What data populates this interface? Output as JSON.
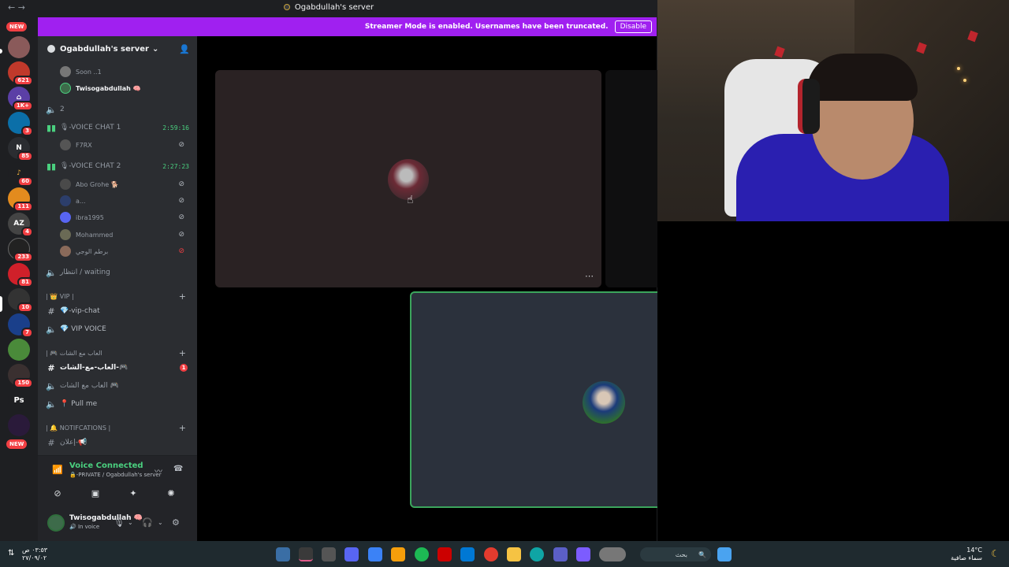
{
  "window": {
    "title": "Ogabdullah's server",
    "nav_back": "←",
    "nav_forward": "→"
  },
  "banner": {
    "message": "Streamer Mode is enabled. Usernames have been truncated.",
    "button": "Disable"
  },
  "rail": {
    "badges": [
      "NEW",
      "621",
      "1K+",
      "3",
      "85",
      "60",
      "111",
      "4",
      "233",
      "81",
      "10",
      "7",
      "150",
      "Ps",
      "NEW"
    ]
  },
  "sidebar": {
    "server_name": "Ogabdullah's server",
    "dropdown_icon": "⌄",
    "members_top": [
      {
        "name": "Soon ..1"
      },
      {
        "name": "Twisogabdullah 🧠"
      }
    ],
    "channel_2": "2",
    "voice1": {
      "name": "🎙-VOICE CHAT 1",
      "timer": "2:59:16",
      "members": [
        {
          "name": "F7RX"
        }
      ]
    },
    "voice2": {
      "name": "🎙-VOICE CHAT 2",
      "timer": "2:27:23",
      "members": [
        {
          "name": "Abo Grohe 🐕"
        },
        {
          "name": "a..."
        },
        {
          "name": "ibra1995"
        },
        {
          "name": "Mohammed"
        },
        {
          "name": "برطم الوجي"
        }
      ]
    },
    "waiting": "انتظار / waiting",
    "cat_vip": "| 👑 VIP |",
    "vip_chat": "💎-vip-chat",
    "vip_voice": "💎 VIP VOICE",
    "cat_games": "| 🎮 العاب مع الشات",
    "games_chat": "العاب-مع-الشات-🎮",
    "games_voice": "العاب مع الشات 🎮",
    "games_mentions": "1",
    "pull_me": "📍 Pull me",
    "cat_notif": "| 🔔 NOTIFCATIONS |",
    "announce": "إعلان-📢"
  },
  "voice_panel": {
    "title": "Voice Connected",
    "subtitle": "🔒-PRIVATE / Ogabdullah's server"
  },
  "user_panel": {
    "username": "Twisogabdullah 🧠",
    "status": "🔊 In voice"
  },
  "stage": {
    "more": "⋯"
  },
  "taskbar": {
    "time": "٠٣:٥٣ ص",
    "date": "٢٧/٠٩/٠٢",
    "search": "بحث",
    "temp": "14°C",
    "weather": "سماء صافية"
  },
  "colors": {
    "banner": "#a020f0",
    "speaking": "#3ba55c",
    "voice_green": "#4ad07f",
    "badge_red": "#f23f43"
  }
}
